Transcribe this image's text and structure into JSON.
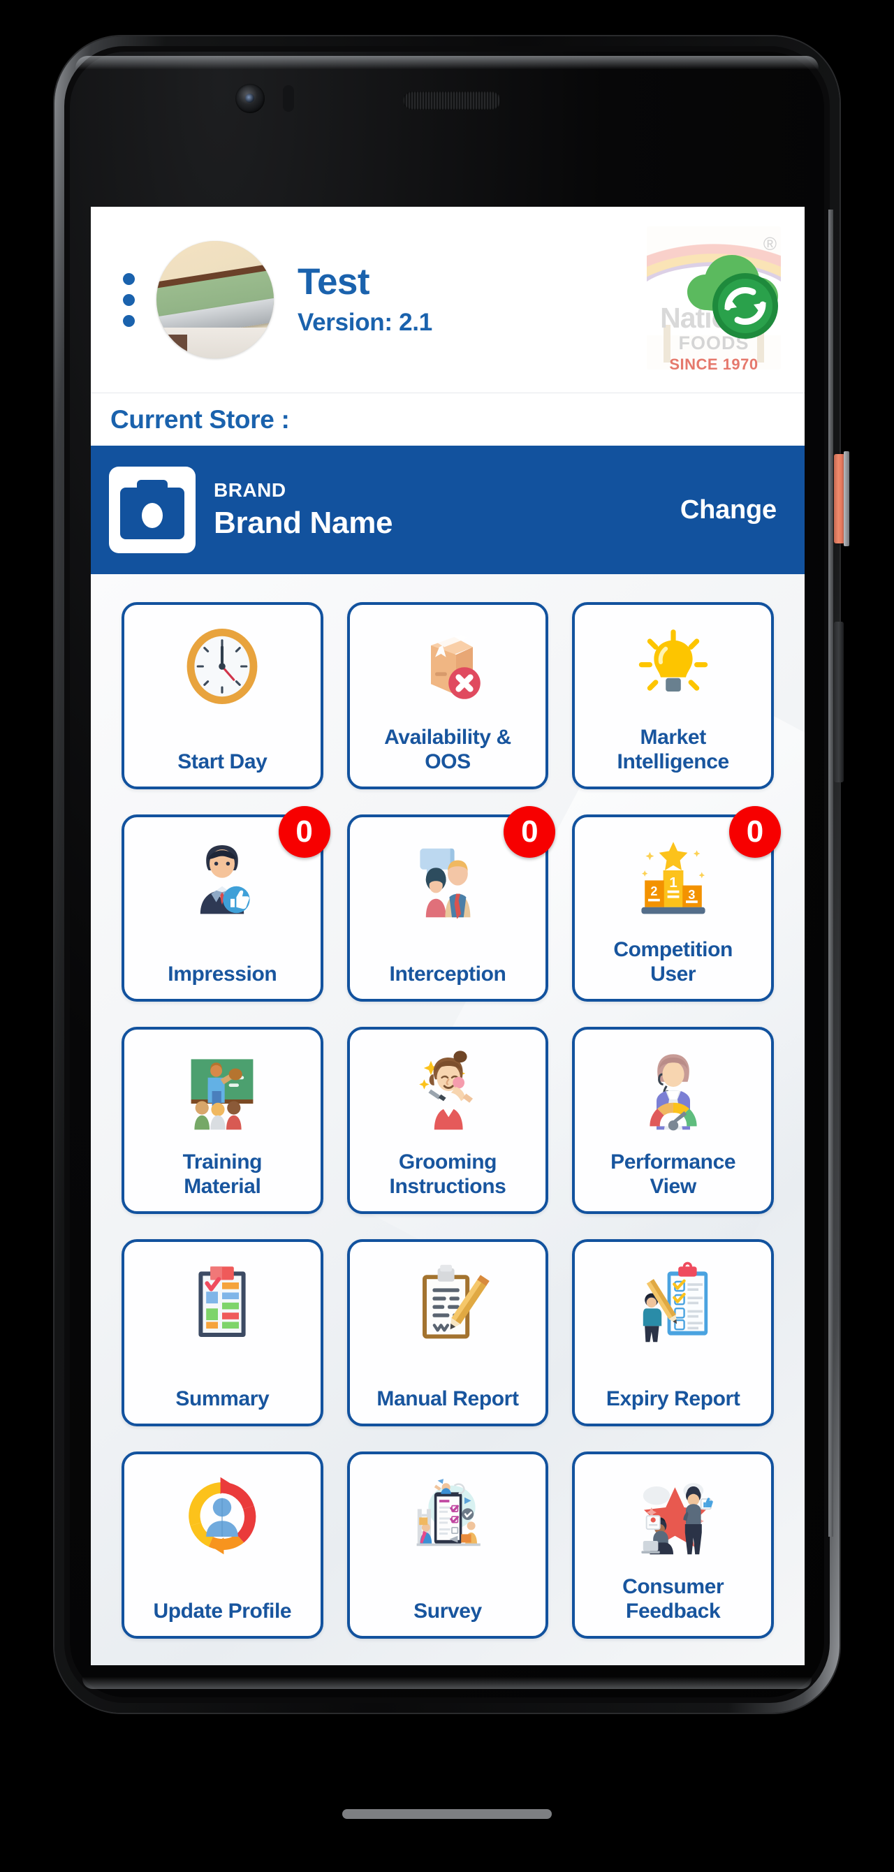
{
  "colors": {
    "brand_blue": "#12529e",
    "text_blue": "#18559e",
    "badge_red": "#f70000",
    "screen_bg": "#f2f4f6"
  },
  "header": {
    "menu_icon": "kebab-menu-icon",
    "avatar_icon": "user-avatar-photo",
    "user_name": "Test",
    "version": "Version: 2.1",
    "logo": {
      "icon": "national-foods-logo",
      "word": "National",
      "sub": "FOODS",
      "since": "SINCE 1970",
      "registered": "®",
      "overlay_icon": "cloud-sync-icon"
    }
  },
  "current_store": {
    "label": "Current Store :"
  },
  "brand_bar": {
    "camera_icon": "camera-icon",
    "kicker": "BRAND",
    "name": "Brand Name",
    "change_label": "Change"
  },
  "tiles": [
    {
      "label": "Start Day",
      "icon": "clock-icon",
      "badge": null
    },
    {
      "label": "Availability &\nOOS",
      "icon": "box-error-icon",
      "badge": null
    },
    {
      "label": "Market\nIntelligence",
      "icon": "lightbulb-icon",
      "badge": null
    },
    {
      "label": "Impression",
      "icon": "businessman-thumbsup-icon",
      "badge": "0"
    },
    {
      "label": "Interception",
      "icon": "two-people-chat-icon",
      "badge": "0"
    },
    {
      "label": "Competition\nUser",
      "icon": "podium-star-icon",
      "badge": "0"
    },
    {
      "label": "Training\nMaterial",
      "icon": "chalkboard-class-icon",
      "badge": null
    },
    {
      "label": "Grooming\nInstructions",
      "icon": "makeup-woman-icon",
      "badge": null
    },
    {
      "label": "Performance\nView",
      "icon": "gauge-agent-icon",
      "badge": null
    },
    {
      "label": "Summary",
      "icon": "checklist-color-icon",
      "badge": null
    },
    {
      "label": "Manual Report",
      "icon": "clipboard-pencil-icon",
      "badge": null
    },
    {
      "label": "Expiry Report",
      "icon": "person-checklist-icon",
      "badge": null
    },
    {
      "label": "Update Profile",
      "icon": "refresh-user-icon",
      "badge": null
    },
    {
      "label": "Survey",
      "icon": "survey-tablet-icon",
      "badge": null
    },
    {
      "label": "Consumer\nFeedback",
      "icon": "star-people-icon",
      "badge": null
    }
  ],
  "device": {
    "camera_icon": "front-camera-icon",
    "earpiece_icon": "earpiece-speaker-icon",
    "power_button": "power-button",
    "volume_button": "volume-rocker",
    "home_indicator": "home-indicator"
  }
}
